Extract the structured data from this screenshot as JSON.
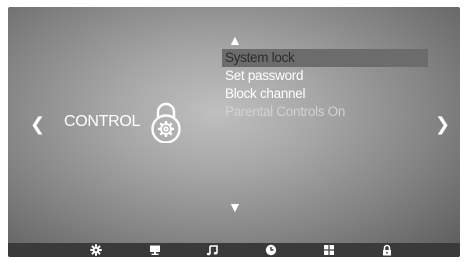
{
  "control": {
    "label": "CONTROL",
    "icon": "lock-gear-icon"
  },
  "menu": {
    "items": [
      {
        "label": "System lock",
        "state": "selected"
      },
      {
        "label": "Set password",
        "state": "normal"
      },
      {
        "label": "Block channel",
        "state": "normal"
      },
      {
        "label": "Parental Controls On",
        "state": "disabled"
      }
    ]
  },
  "nav": {
    "up": "▲",
    "down": "▼",
    "left": "❮",
    "right": "❯"
  },
  "bottom_bar": {
    "icons": [
      "settings-icon",
      "picture-icon",
      "music-icon",
      "time-icon",
      "apps-icon",
      "lock-icon"
    ],
    "background": "#3a3a3a"
  },
  "colors": {
    "highlight": "#6c6c6c",
    "text": "#ffffff",
    "disabled": "#d2d2d2"
  }
}
